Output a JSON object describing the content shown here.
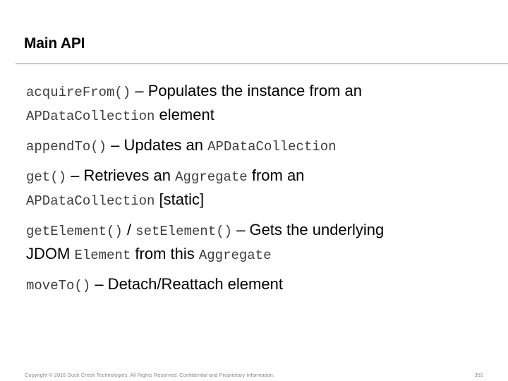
{
  "slide": {
    "title": "Main API",
    "items": [
      {
        "code1": "acquireFrom()",
        "text1": " – Populates the instance from an",
        "code2": "APDataCollection",
        "text2": " element"
      },
      {
        "code1": "appendTo()",
        "text1": " – Updates an ",
        "code2": "APDataCollection"
      },
      {
        "code1": "get()",
        "text1": " – Retrieves an ",
        "code2": "Aggregate",
        "text2": " from an",
        "code3": "APDataCollection",
        "text3": " [static]"
      },
      {
        "code1": "getElement()",
        "text1": " / ",
        "code2": "setElement()",
        "text2": " – Gets the underlying",
        "text3": "JDOM ",
        "code3": "Element",
        "text4": " from this ",
        "code4": "Aggregate"
      },
      {
        "code1": "moveTo()",
        "text1": " – Detach/Reattach element"
      }
    ]
  },
  "footer": {
    "copyright": "Copyright © 2016 Duck Creek Technologies. All Rights Reserved. Confidential and Proprietary Information.",
    "page_number": "352"
  },
  "colors": {
    "rule": "#5fa7c4",
    "code_text": "#3c3c3c",
    "footer_text": "#8a8a8a"
  }
}
